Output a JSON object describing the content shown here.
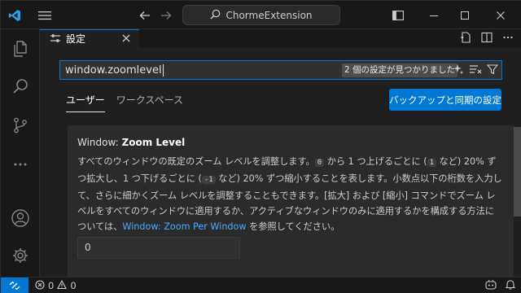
{
  "titlebar": {
    "command_center_text": "ChormeExtension"
  },
  "tab": {
    "label": "設定"
  },
  "search": {
    "value": "window.zoomlevel",
    "result_count": "2 個の設定が見つかりました"
  },
  "scopes": {
    "user": "ユーザー",
    "workspace": "ワークスペース"
  },
  "sync_button": "バックアップと同期の設定",
  "setting": {
    "category": "Window: ",
    "name": "Zoom Level",
    "desc_1": "すべてのウィンドウの既定のズーム レベルを調整します。",
    "code_0": "0",
    "desc_2": " から 1 つ上げるごとに (",
    "code_1": "1",
    "desc_3": " など) 20% ずつ拡大し、1 つ下げるごとに (",
    "code_m1": "-1",
    "desc_4": " など) 20% ずつ縮小することを表します。小数点以下の桁数を入力して、さらに細かくズーム レベルを調整することもできます。[拡大] および [縮小] コマンドでズーム レベルをすべてのウィンドウに適用するか、アクティブなウィンドウのみに適用するかを構成する方法については、",
    "link": "Window: Zoom Per Window",
    "desc_5": " を参照してください。",
    "value": "0"
  },
  "statusbar": {
    "errors": "0",
    "warnings": "0"
  },
  "colors": {
    "accent": "#0078d4",
    "link": "#4daafc",
    "background": "#1f1f1f"
  }
}
